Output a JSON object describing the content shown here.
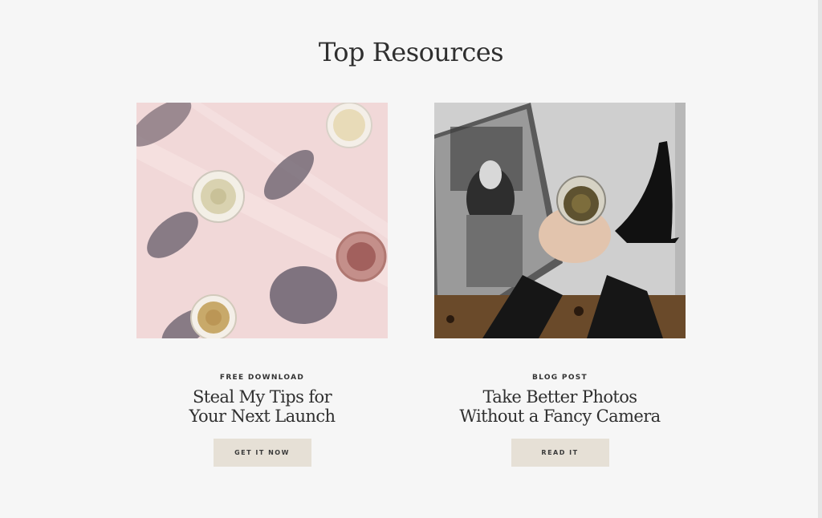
{
  "section": {
    "title": "Top Resources"
  },
  "cards": [
    {
      "eyebrow": "FREE DOWNLOAD",
      "title_lines": [
        "Steal My Tips for",
        "Your Next Launch"
      ],
      "cta_label": "GET IT NOW"
    },
    {
      "eyebrow": "BLOG POST",
      "title_lines": [
        "Take Better Photos",
        "Without a Fancy Camera"
      ],
      "cta_label": "READ IT"
    }
  ],
  "colors": {
    "page_background": "#f6f6f6",
    "button_background": "#e6e0d6",
    "text": "#2f2f2f"
  }
}
